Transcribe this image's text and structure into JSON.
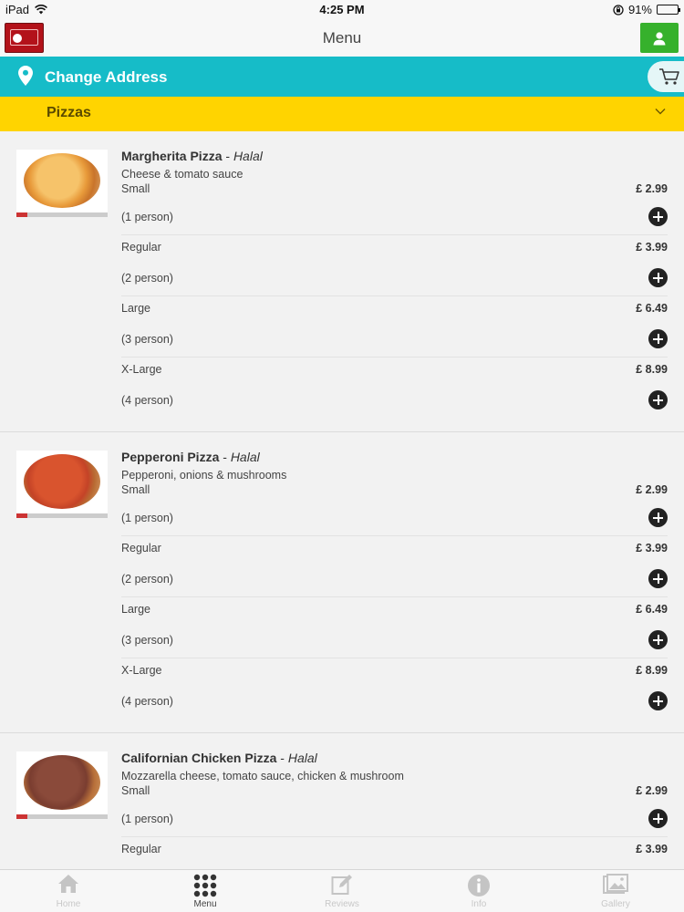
{
  "status_bar": {
    "device": "iPad",
    "time": "4:25 PM",
    "battery": "91%"
  },
  "header": {
    "title": "Menu"
  },
  "address_bar": {
    "label": "Change Address"
  },
  "category": {
    "label": "Pizzas"
  },
  "products": [
    {
      "name": "Margherita Pizza",
      "separator": " - ",
      "tag": "Halal",
      "description": "Cheese & tomato sauce",
      "options": [
        {
          "size": "Small",
          "persons": "(1 person)",
          "price": "£ 2.99"
        },
        {
          "size": "Regular",
          "persons": "(2 person)",
          "price": "£ 3.99"
        },
        {
          "size": "Large",
          "persons": "(3 person)",
          "price": "£ 6.49"
        },
        {
          "size": "X-Large",
          "persons": "(4 person)",
          "price": "£ 8.99"
        }
      ]
    },
    {
      "name": "Pepperoni Pizza",
      "separator": " - ",
      "tag": "Halal",
      "description": "Pepperoni, onions & mushrooms",
      "options": [
        {
          "size": "Small",
          "persons": "(1 person)",
          "price": "£ 2.99"
        },
        {
          "size": "Regular",
          "persons": "(2 person)",
          "price": "£ 3.99"
        },
        {
          "size": "Large",
          "persons": "(3 person)",
          "price": "£ 6.49"
        },
        {
          "size": "X-Large",
          "persons": "(4 person)",
          "price": "£ 8.99"
        }
      ]
    },
    {
      "name": "Californian Chicken Pizza",
      "separator": " - ",
      "tag": "Halal",
      "description": "Mozzarella cheese, tomato sauce, chicken & mushroom",
      "options": [
        {
          "size": "Small",
          "persons": "(1 person)",
          "price": "£ 2.99"
        },
        {
          "size": "Regular",
          "persons": "",
          "price": "£ 3.99"
        }
      ]
    }
  ],
  "tabs": [
    {
      "label": "Home",
      "icon": "home-icon"
    },
    {
      "label": "Menu",
      "icon": "menu-grid-icon"
    },
    {
      "label": "Reviews",
      "icon": "edit-icon"
    },
    {
      "label": "Info",
      "icon": "info-icon"
    },
    {
      "label": "Gallery",
      "icon": "gallery-icon"
    }
  ],
  "colors": {
    "address_bar": "#16bcc8",
    "category_bar": "#ffd400",
    "user_button": "#36b12c"
  }
}
